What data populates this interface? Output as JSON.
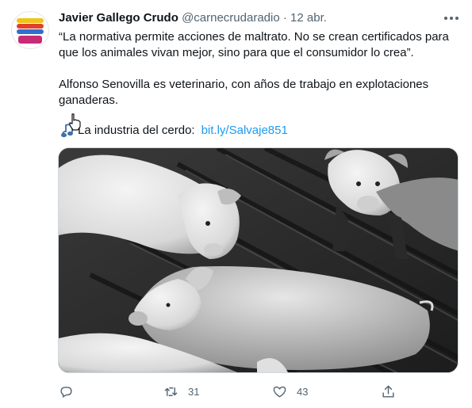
{
  "tweet": {
    "author_name": "Javier Gallego Crudo",
    "handle": "@carnecrudaradio",
    "separator": "·",
    "date": "12 abr.",
    "text_p1": "“La normativa permite acciones de maltrato. No se crean certificados para que los animales vivan mejor, sino para que el consumidor lo crea”.",
    "text_p2": "Alfonso Senovilla es veterinario, con años de trabajo en explotaciones ganaderas.",
    "text_p3": "La industria del cerdo:",
    "link": "bit.ly/Salvaje851",
    "image_icon": "photo-of-pigs-on-slatted-floor",
    "more_icon": "ellipsis-icon"
  },
  "actions": {
    "reply_count": "",
    "retweet_count": "31",
    "like_count": "43",
    "share_count": ""
  },
  "colors": {
    "link": "#1d9bf0",
    "secondary_text": "#536471",
    "primary_text": "#0f1419"
  }
}
